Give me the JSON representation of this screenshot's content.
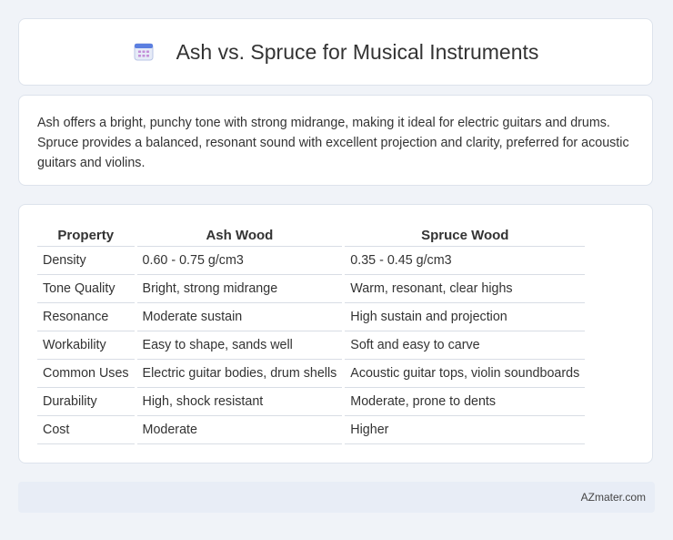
{
  "header": {
    "title": "Ash vs. Spruce for Musical Instruments",
    "icon": "calendar-icon"
  },
  "intro": {
    "text": "Ash offers a bright, punchy tone with strong midrange, making it ideal for electric guitars and drums. Spruce provides a balanced, resonant sound with excellent projection and clarity, preferred for acoustic guitars and violins."
  },
  "table": {
    "headers": [
      "Property",
      "Ash Wood",
      "Spruce Wood"
    ],
    "rows": [
      [
        "Density",
        "0.60 - 0.75 g/cm3",
        "0.35 - 0.45 g/cm3"
      ],
      [
        "Tone Quality",
        "Bright, strong midrange",
        "Warm, resonant, clear highs"
      ],
      [
        "Resonance",
        "Moderate sustain",
        "High sustain and projection"
      ],
      [
        "Workability",
        "Easy to shape, sands well",
        "Soft and easy to carve"
      ],
      [
        "Common Uses",
        "Electric guitar bodies, drum shells",
        "Acoustic guitar tops, violin soundboards"
      ],
      [
        "Durability",
        "High, shock resistant",
        "Moderate, prone to dents"
      ],
      [
        "Cost",
        "Moderate",
        "Higher"
      ]
    ]
  },
  "footer": {
    "brand": "AZmater.com"
  },
  "colors": {
    "background": "#f0f3f8",
    "card": "#ffffff",
    "footer_bg": "#e8edf6",
    "icon_accent": "#5b7fe0"
  }
}
